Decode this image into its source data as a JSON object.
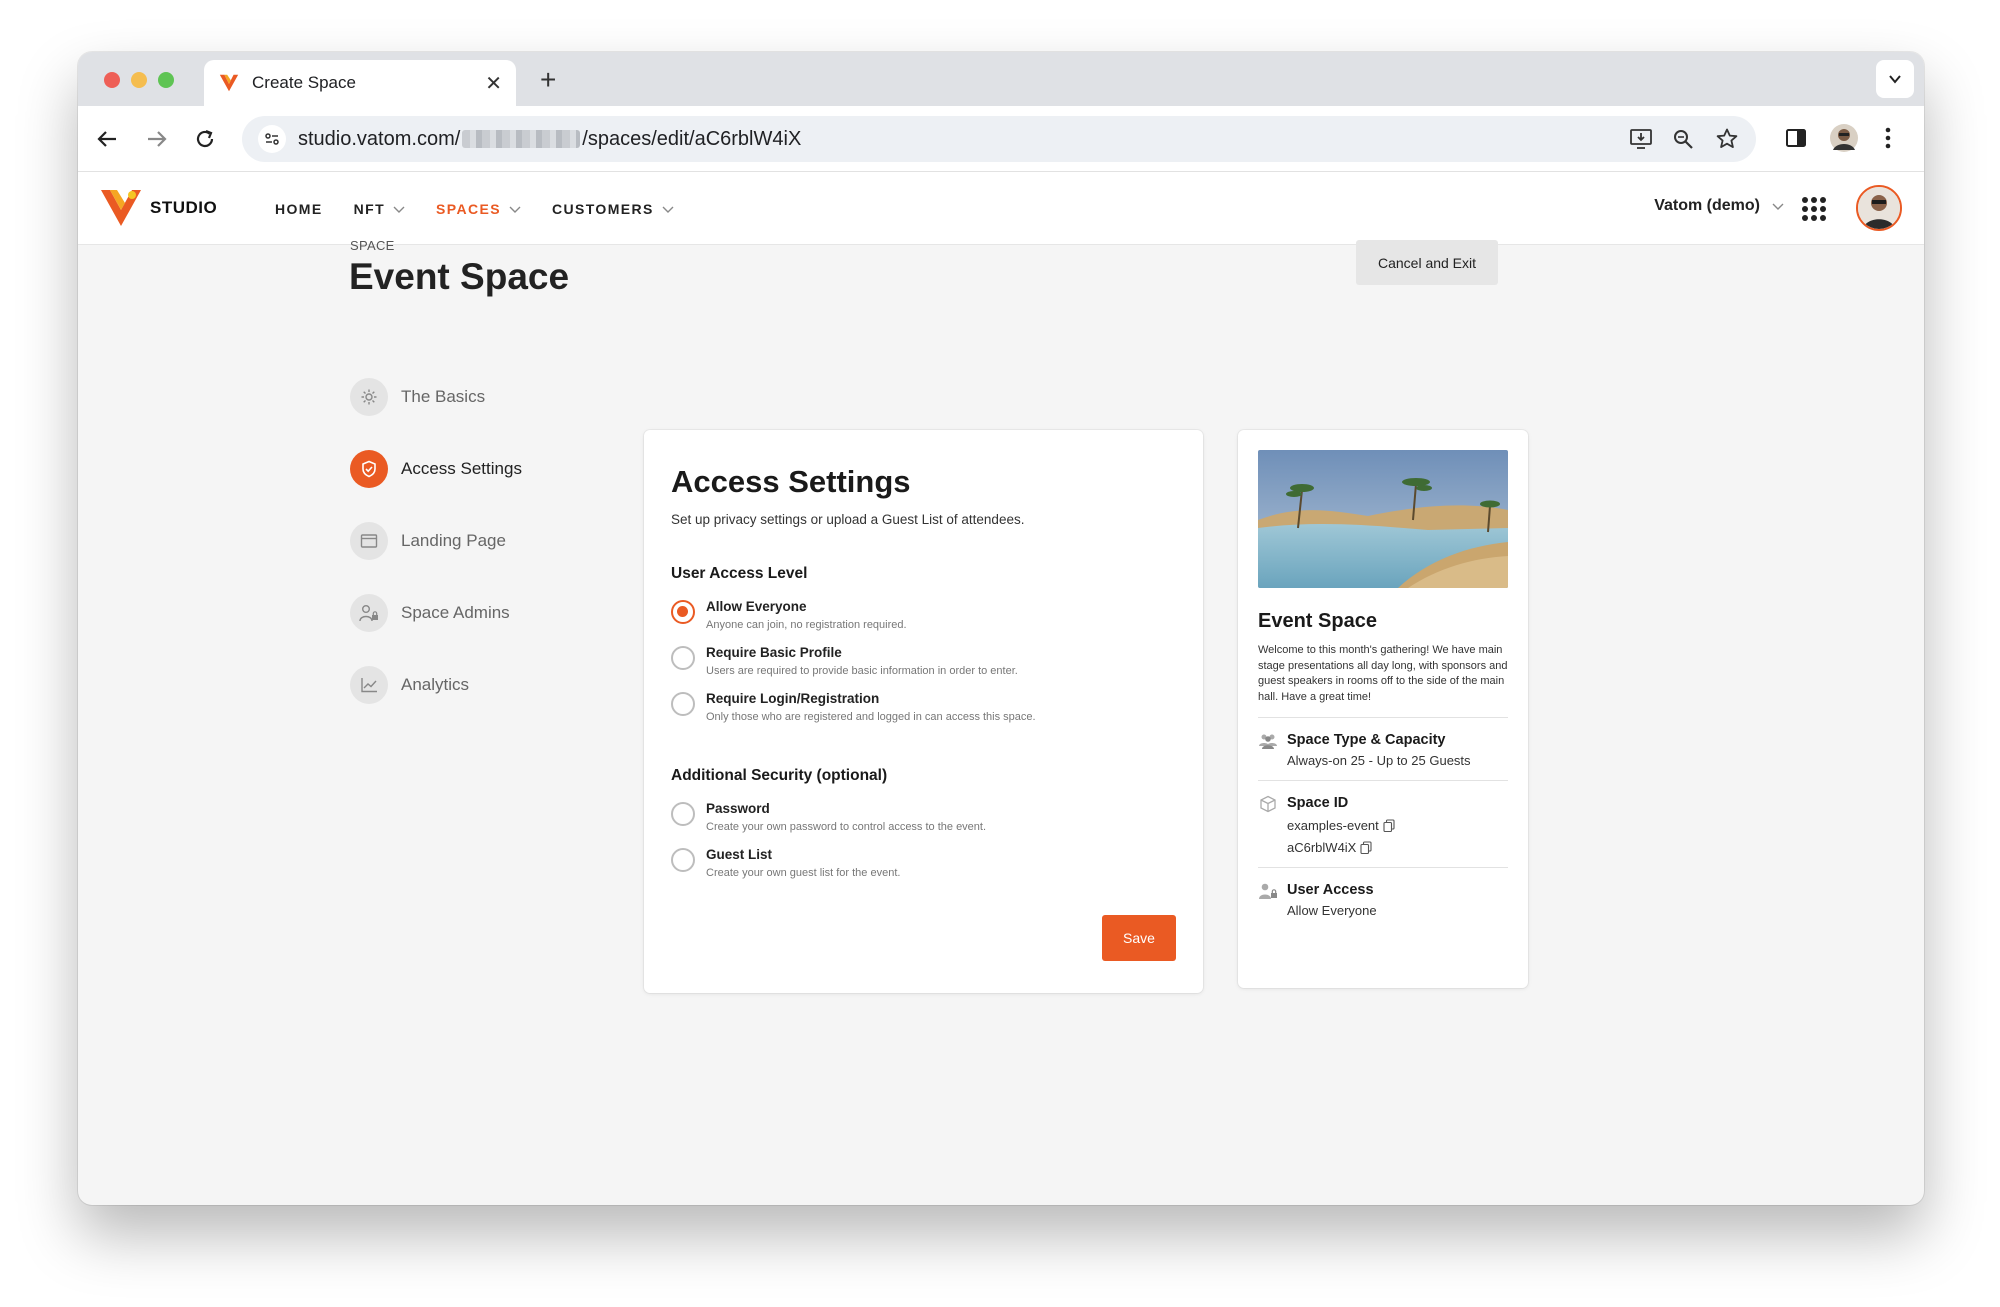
{
  "browser": {
    "tab_title": "Create Space",
    "url_prefix": "studio.vatom.com/",
    "url_suffix": "/spaces/edit/aC6rblW4iX"
  },
  "header": {
    "logo_text": "STUDIO",
    "nav": [
      {
        "label": "HOME",
        "has_dropdown": false
      },
      {
        "label": "NFT",
        "has_dropdown": true
      },
      {
        "label": "SPACES",
        "has_dropdown": true,
        "active": true
      },
      {
        "label": "CUSTOMERS",
        "has_dropdown": true
      }
    ],
    "account_label": "Vatom (demo)"
  },
  "page": {
    "eyebrow": "SPACE",
    "title": "Event Space",
    "cancel_label": "Cancel and Exit"
  },
  "steps": [
    {
      "label": "The Basics",
      "icon": "gear-icon"
    },
    {
      "label": "Access Settings",
      "icon": "shield-icon",
      "active": true
    },
    {
      "label": "Landing Page",
      "icon": "browser-window-icon"
    },
    {
      "label": "Space Admins",
      "icon": "user-lock-icon"
    },
    {
      "label": "Analytics",
      "icon": "chart-line-icon"
    }
  ],
  "access": {
    "title": "Access Settings",
    "subtitle": "Set up privacy settings or upload a Guest List of attendees.",
    "user_level_title": "User Access Level",
    "user_levels": [
      {
        "label": "Allow Everyone",
        "desc": "Anyone can join, no registration required.",
        "checked": true
      },
      {
        "label": "Require Basic Profile",
        "desc": "Users are required to provide basic information in order to enter.",
        "checked": false
      },
      {
        "label": "Require Login/Registration",
        "desc": "Only those who are registered and logged in can access this space.",
        "checked": false
      }
    ],
    "security_title": "Additional Security (optional)",
    "security": [
      {
        "label": "Password",
        "desc": "Create your own password to control access to the event.",
        "checked": false
      },
      {
        "label": "Guest List",
        "desc": "Create your own guest list for the event.",
        "checked": false
      }
    ],
    "save_label": "Save"
  },
  "summary": {
    "title": "Event Space",
    "description": "Welcome to this month's gathering! We have main stage presentations all day long, with sponsors and guest speakers in rooms off to the side of the main hall. Have a great time!",
    "type_title": "Space Type & Capacity",
    "type_value": "Always-on 25 - Up to 25 Guests",
    "id_title": "Space ID",
    "id_slug": "examples-event",
    "id_code": "aC6rblW4iX",
    "user_access_title": "User Access",
    "user_access_value": "Allow Everyone"
  },
  "colors": {
    "accent": "#ea5a23",
    "page_bg": "#f5f5f5"
  }
}
